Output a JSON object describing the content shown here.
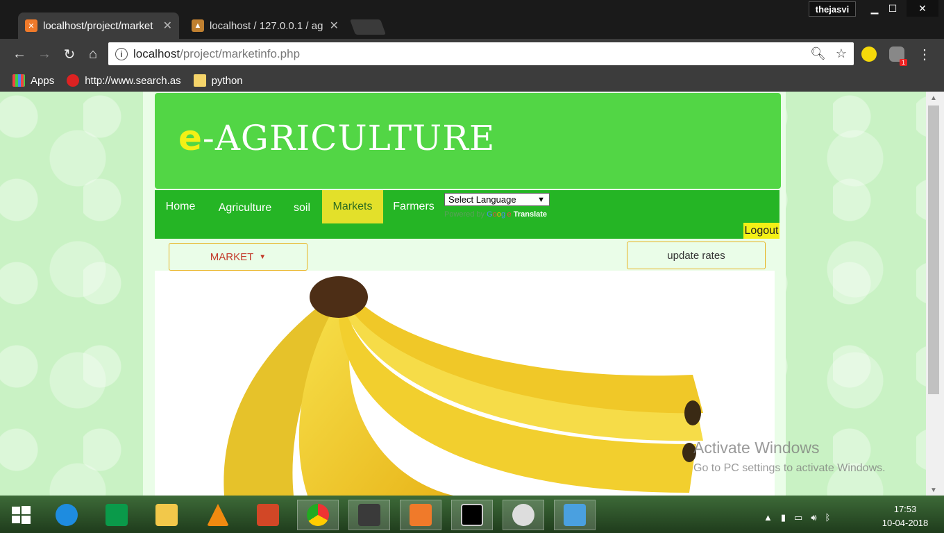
{
  "browser": {
    "tabs": [
      {
        "title": "localhost/project/market",
        "active": true
      },
      {
        "title": "localhost / 127.0.0.1 / ag",
        "active": false
      }
    ],
    "profile": "thejasvi",
    "url_host": "localhost",
    "url_path": "/project/marketinfo.php",
    "bookmarks": [
      "Apps",
      "http://www.search.as",
      "python"
    ],
    "extension_badge": "1"
  },
  "site": {
    "logo_e": "e",
    "logo_rest": "-AGRICULTURE",
    "nav": [
      {
        "label": "Home",
        "active": false
      },
      {
        "label": "Agriculture",
        "active": false
      },
      {
        "label": "soil",
        "active": false
      },
      {
        "label": "Markets",
        "active": true
      },
      {
        "label": "Farmers",
        "active": false
      }
    ],
    "language_select": "Select Language",
    "powered_by": "Powered by",
    "translate_label": "Translate",
    "logout": "Logout",
    "market_button": "MARKET",
    "update_button": "update rates"
  },
  "watermark": {
    "line1": "Activate Windows",
    "line2": "Go to PC settings to activate Windows."
  },
  "taskbar": {
    "time": "17:53",
    "date": "10-04-2018"
  },
  "colors": {
    "header_green": "#52d645",
    "nav_green": "#25b525",
    "accent_yellow": "#f3f016"
  }
}
